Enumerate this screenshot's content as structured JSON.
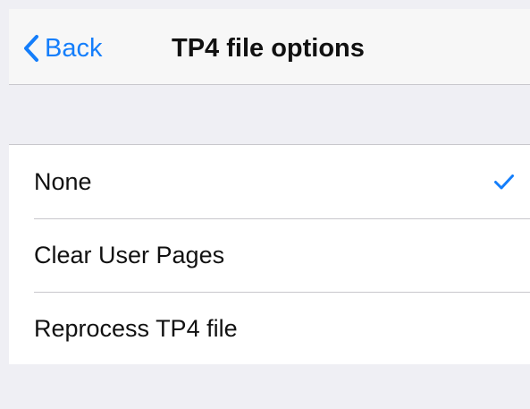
{
  "colors": {
    "accent": "#147efb",
    "nav_background": "#f7f7f7",
    "list_background": "#ffffff",
    "group_background": "#efeff4",
    "separator": "#c8c7cc",
    "text": "#111111"
  },
  "nav": {
    "back_label": "Back",
    "back_icon": "chevron-left-icon",
    "title": "TP4 file options"
  },
  "options": [
    {
      "label": "None",
      "selected": true,
      "selected_icon": "checkmark-icon"
    },
    {
      "label": "Clear User Pages",
      "selected": false
    },
    {
      "label": "Reprocess TP4 file",
      "selected": false
    }
  ]
}
